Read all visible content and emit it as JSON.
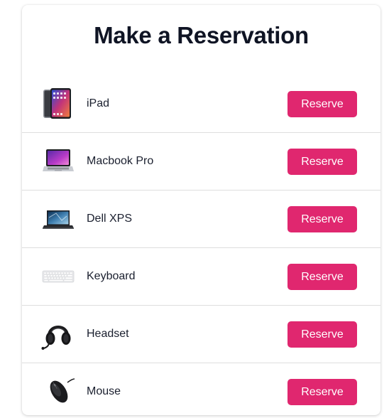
{
  "page": {
    "title": "Make a Reservation",
    "accent_color": "#e0276f"
  },
  "items": [
    {
      "name": "iPad",
      "icon": "ipad-icon",
      "button_label": "Reserve"
    },
    {
      "name": "Macbook Pro",
      "icon": "macbook-pro-icon",
      "button_label": "Reserve"
    },
    {
      "name": "Dell XPS",
      "icon": "dell-xps-icon",
      "button_label": "Reserve"
    },
    {
      "name": "Keyboard",
      "icon": "keyboard-icon",
      "button_label": "Reserve"
    },
    {
      "name": "Headset",
      "icon": "headset-icon",
      "button_label": "Reserve"
    },
    {
      "name": "Mouse",
      "icon": "mouse-icon",
      "button_label": "Reserve"
    }
  ]
}
